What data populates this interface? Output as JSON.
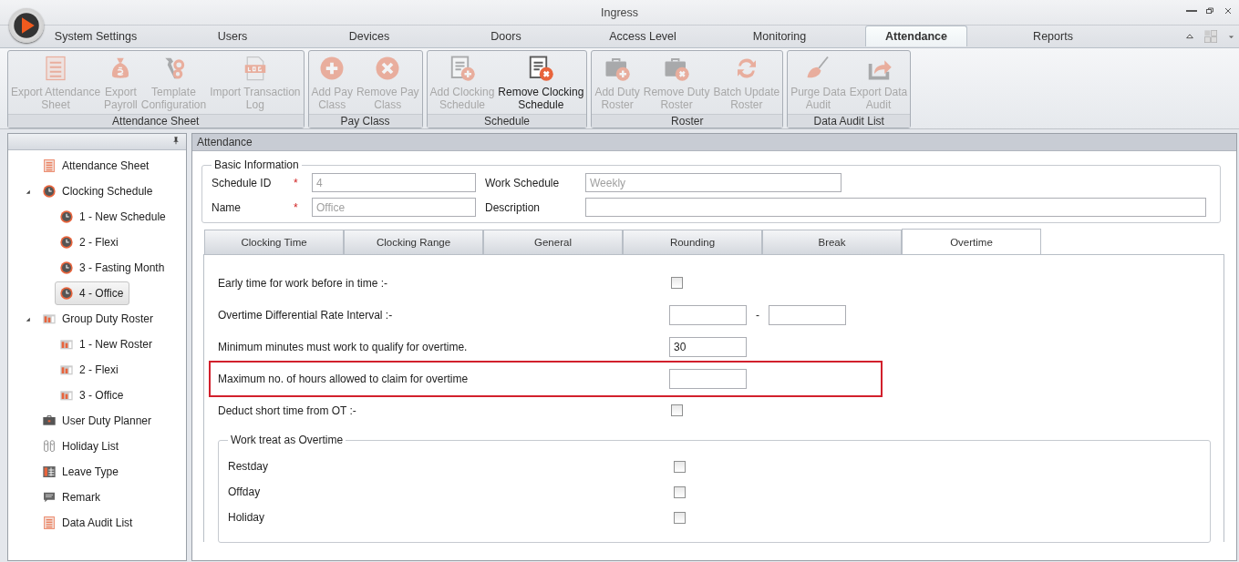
{
  "window": {
    "title": "Ingress"
  },
  "menu_tabs": [
    {
      "label": "System Settings",
      "selected": false
    },
    {
      "label": "Users",
      "selected": false
    },
    {
      "label": "Devices",
      "selected": false
    },
    {
      "label": "Doors",
      "selected": false
    },
    {
      "label": "Access Level",
      "selected": false
    },
    {
      "label": "Monitoring",
      "selected": false
    },
    {
      "label": "Attendance",
      "selected": true
    },
    {
      "label": "Reports",
      "selected": false
    }
  ],
  "ribbon_groups": [
    {
      "label": "Attendance Sheet",
      "buttons": [
        {
          "lines": [
            "Export Attendance",
            "Sheet"
          ],
          "disabled": true
        },
        {
          "lines": [
            "Export",
            "Payroll"
          ],
          "disabled": true
        },
        {
          "lines": [
            "Template",
            "Configuration"
          ],
          "disabled": true
        },
        {
          "lines": [
            "Import Transaction",
            "Log"
          ],
          "disabled": true
        }
      ]
    },
    {
      "label": "Pay Class",
      "buttons": [
        {
          "lines": [
            "Add Pay",
            "Class"
          ],
          "disabled": true
        },
        {
          "lines": [
            "Remove Pay",
            "Class"
          ],
          "disabled": true
        }
      ]
    },
    {
      "label": "Schedule",
      "buttons": [
        {
          "lines": [
            "Add Clocking",
            "Schedule"
          ],
          "disabled": true
        },
        {
          "lines": [
            "Remove Clocking",
            "Schedule"
          ],
          "disabled": false
        }
      ]
    },
    {
      "label": "Roster",
      "buttons": [
        {
          "lines": [
            "Add Duty",
            "Roster"
          ],
          "disabled": true
        },
        {
          "lines": [
            "Remove Duty",
            "Roster"
          ],
          "disabled": true
        },
        {
          "lines": [
            "Batch Update",
            "Roster"
          ],
          "disabled": true
        }
      ]
    },
    {
      "label": "Data Audit List",
      "buttons": [
        {
          "lines": [
            "Purge Data",
            "Audit"
          ],
          "disabled": true
        },
        {
          "lines": [
            "Export Data",
            "Audit"
          ],
          "disabled": true
        }
      ]
    }
  ],
  "sidebar": {
    "items": [
      {
        "label": "Attendance Sheet",
        "selected": false
      },
      {
        "label": "Clocking Schedule",
        "selected": false,
        "expanded": true,
        "children": [
          {
            "label": "1 - New Schedule",
            "selected": false
          },
          {
            "label": "2 - Flexi",
            "selected": false
          },
          {
            "label": "3 - Fasting Month",
            "selected": false
          },
          {
            "label": "4 - Office",
            "selected": true
          }
        ]
      },
      {
        "label": "Group Duty Roster",
        "selected": false,
        "expanded": true,
        "children": [
          {
            "label": "1 - New Roster",
            "selected": false
          },
          {
            "label": "2 - Flexi",
            "selected": false
          },
          {
            "label": "3 - Office",
            "selected": false
          }
        ]
      },
      {
        "label": "User Duty Planner",
        "selected": false
      },
      {
        "label": "Holiday List",
        "selected": false
      },
      {
        "label": "Leave Type",
        "selected": false
      },
      {
        "label": "Remark",
        "selected": false
      },
      {
        "label": "Data Audit List",
        "selected": false
      }
    ]
  },
  "panel": {
    "title": "Attendance",
    "basic_information": {
      "title": "Basic Information",
      "fields": [
        {
          "label": "Schedule ID",
          "required_mark": "*",
          "value": "4",
          "disabled": true
        },
        {
          "label": "Work Schedule",
          "value": "Weekly",
          "disabled": true
        },
        {
          "label": "Name",
          "required_mark": "*",
          "value": "Office",
          "disabled": true
        },
        {
          "label": "Description"
        }
      ]
    },
    "tabs": [
      {
        "label": "Clocking Time",
        "selected": false
      },
      {
        "label": "Clocking Range",
        "selected": false
      },
      {
        "label": "General",
        "selected": false
      },
      {
        "label": "Rounding",
        "selected": false
      },
      {
        "label": "Break",
        "selected": false
      },
      {
        "label": "Overtime",
        "selected": true
      }
    ],
    "overtime": {
      "rows": [
        {
          "kind": "checkbox",
          "label": "Early time for work before in time :-",
          "checked": false,
          "highlighted": false
        },
        {
          "kind": "range",
          "label": "Overtime Differential Rate Interval :-",
          "separator": "-",
          "highlighted": false
        },
        {
          "kind": "input",
          "label": "Minimum minutes must work to qualify for overtime.",
          "value": "30",
          "highlighted": false
        },
        {
          "kind": "input",
          "label": "Maximum no. of hours allowed to claim for overtime",
          "highlighted": true
        },
        {
          "kind": "checkbox",
          "label": "Deduct short time from OT :-",
          "checked": false,
          "highlighted": false
        }
      ],
      "group": {
        "title": "Work treat as Overtime",
        "rows": [
          {
            "label": "Restday",
            "checked": false
          },
          {
            "label": "Offday",
            "checked": false
          },
          {
            "label": "Holiday",
            "checked": false
          }
        ]
      }
    }
  }
}
